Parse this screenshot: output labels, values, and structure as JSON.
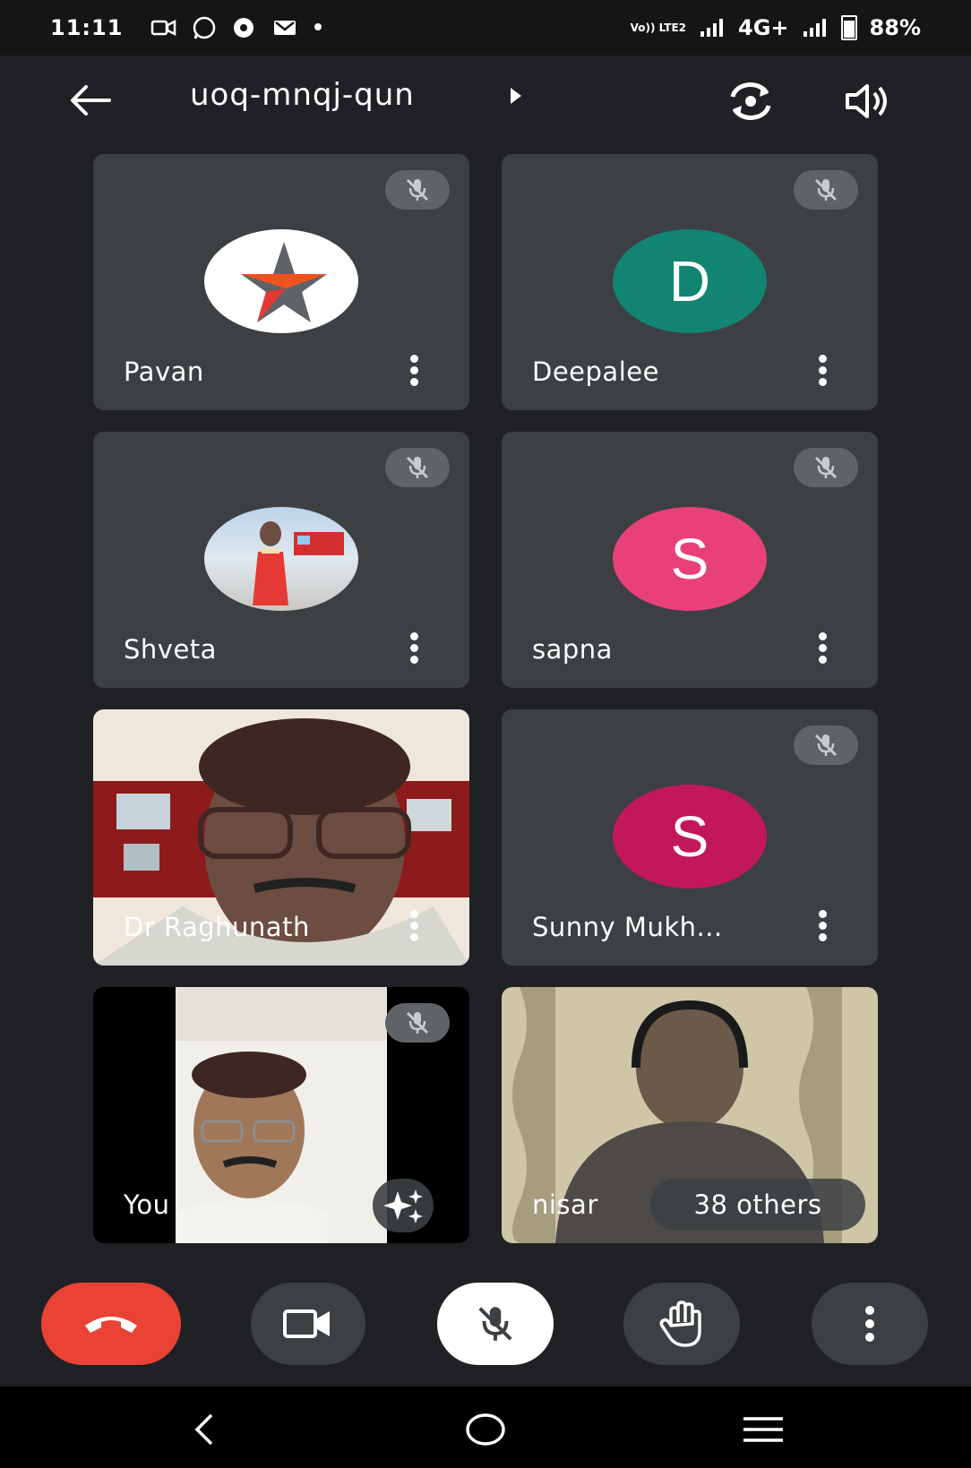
{
  "status_bar": {
    "time": "11:11",
    "network": "4G+",
    "battery": "88%",
    "volte": "Vo)) LTE2"
  },
  "top_bar": {
    "meeting_code": "uoq-mnqj-qun"
  },
  "participants": [
    {
      "name": "Pavan",
      "avatar_type": "star-logo",
      "muted": true
    },
    {
      "name": "Deepalee",
      "avatar_type": "initial",
      "initial": "D",
      "avatar_color": "#128472",
      "muted": true
    },
    {
      "name": "Shveta",
      "avatar_type": "photo",
      "muted": true
    },
    {
      "name": "sapna",
      "avatar_type": "initial",
      "initial": "S",
      "avatar_color": "#e8417a",
      "muted": true
    },
    {
      "name": "Dr Raghunath",
      "avatar_type": "video",
      "muted": false
    },
    {
      "name": "Sunny Mukh...",
      "avatar_type": "initial",
      "initial": "S",
      "avatar_color": "#c2185b",
      "muted": true
    },
    {
      "name": "You",
      "avatar_type": "video",
      "muted": true
    },
    {
      "name": "nisar",
      "avatar_type": "video",
      "muted": false
    }
  ],
  "others_chip": "38 others",
  "controls": {
    "end_call": "end-call-icon",
    "camera": "videocam-icon",
    "mic": "mic-off-icon",
    "raise_hand": "hand-icon",
    "more": "more-vert-icon"
  },
  "colors": {
    "background": "#202124",
    "tile": "#3c4043",
    "end_call": "#ea4335"
  }
}
